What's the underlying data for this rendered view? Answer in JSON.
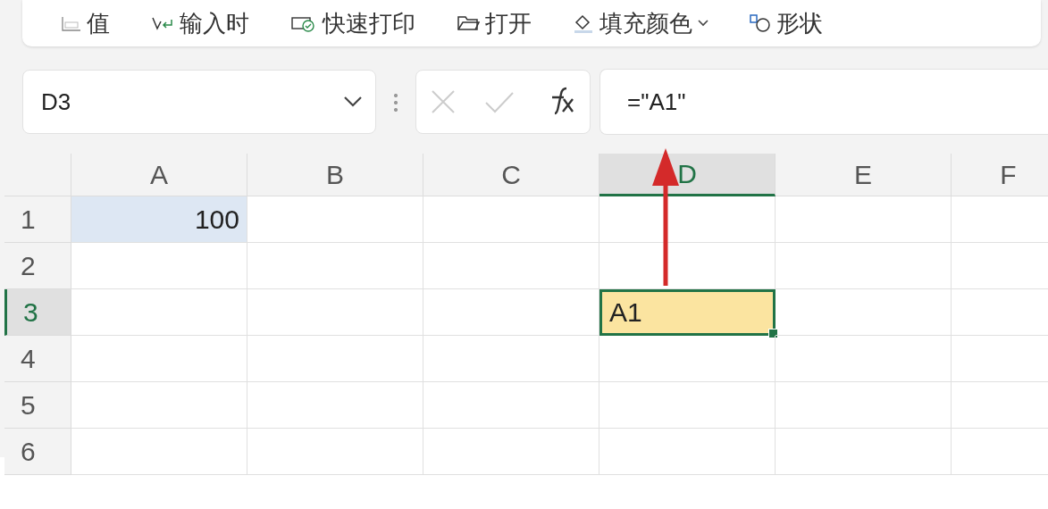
{
  "toolbar": {
    "items": [
      {
        "kind": "number-format",
        "label": "值",
        "dropdown": false
      },
      {
        "kind": "input",
        "label": "输入时",
        "dropdown": false
      },
      {
        "kind": "print",
        "label": "快速打印",
        "dropdown": false
      },
      {
        "kind": "open",
        "label": "打开",
        "dropdown": false
      },
      {
        "kind": "fill",
        "label": "填充颜色",
        "dropdown": true
      },
      {
        "kind": "shape",
        "label": "形状",
        "dropdown": false
      }
    ]
  },
  "formula_bar": {
    "name_box": "D3",
    "formula": "=\"A1\""
  },
  "sheet": {
    "columns": [
      {
        "label": "A",
        "selected": false
      },
      {
        "label": "B",
        "selected": false
      },
      {
        "label": "C",
        "selected": false
      },
      {
        "label": "D",
        "selected": true
      },
      {
        "label": "E",
        "selected": false
      },
      {
        "label": "F",
        "selected": false
      }
    ],
    "rows": [
      {
        "label": "1",
        "selected": false,
        "cells": [
          {
            "value": "100",
            "selected": false,
            "color": "#dde7f3"
          },
          {
            "selected": false
          },
          {
            "selected": false
          },
          {
            "selected": false
          },
          {
            "selected": false
          },
          {
            "selected": false
          }
        ]
      },
      {
        "label": "2",
        "selected": false,
        "cells": [
          {
            "selected": false
          },
          {
            "selected": false
          },
          {
            "selected": false
          },
          {
            "selected": false
          },
          {
            "selected": false
          },
          {
            "selected": false
          }
        ]
      },
      {
        "label": "3",
        "selected": true,
        "cells": [
          {
            "selected": false
          },
          {
            "selected": false
          },
          {
            "selected": false
          },
          {
            "value": "A1",
            "selected": true,
            "color": "#fbe4a0"
          },
          {
            "selected": false
          },
          {
            "selected": false
          }
        ]
      },
      {
        "label": "4",
        "selected": false,
        "cells": [
          {
            "selected": false
          },
          {
            "selected": false
          },
          {
            "selected": false
          },
          {
            "selected": false
          },
          {
            "selected": false
          },
          {
            "selected": false
          }
        ]
      },
      {
        "label": "5",
        "selected": false,
        "cells": [
          {
            "selected": false
          },
          {
            "selected": false
          },
          {
            "selected": false
          },
          {
            "selected": false
          },
          {
            "selected": false
          },
          {
            "selected": false
          }
        ]
      },
      {
        "label": "6",
        "selected": false,
        "cells": [
          {
            "selected": false
          },
          {
            "selected": false
          },
          {
            "selected": false
          },
          {
            "selected": false
          },
          {
            "selected": false
          },
          {
            "selected": false
          }
        ]
      }
    ]
  },
  "annotation": {
    "kind": "arrow"
  }
}
